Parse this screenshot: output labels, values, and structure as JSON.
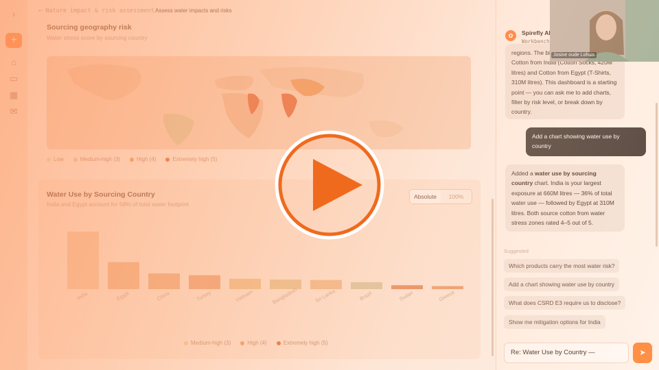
{
  "breadcrumb": {
    "back": "← Nature impact & risk assessment",
    "current": "Assess water impacts and risks"
  },
  "geo_panel": {
    "title": "Sourcing geography risk",
    "subtitle": "Water stress score by sourcing country",
    "legend": [
      {
        "label": "Low",
        "color": "#d9e3b5"
      },
      {
        "label": "Medium-high (3)",
        "color": "#f4c79c"
      },
      {
        "label": "High (4)",
        "color": "#ee9a5c"
      },
      {
        "label": "Extremely high (5)",
        "color": "#e2653a"
      }
    ]
  },
  "water_panel": {
    "title": "Water Use by Sourcing Country",
    "subtitle": "India and Egypt account for 58% of total water footprint",
    "toggle": [
      "Absolute",
      "100%"
    ],
    "legend": [
      {
        "label": "Medium-high (3)",
        "color": "#f4c79c"
      },
      {
        "label": "High (4)",
        "color": "#ee9a5c"
      },
      {
        "label": "Extremely high (5)",
        "color": "#e2653a"
      }
    ]
  },
  "chart_data": {
    "type": "bar",
    "title": "Water Use by Sourcing Country",
    "categories": [
      "India",
      "Egypt",
      "China",
      "Turkey",
      "Vietnam",
      "Bangladesh",
      "Sri Lanka",
      "Brazil",
      "Sudan",
      "Greece"
    ],
    "values": [
      660,
      310,
      180,
      160,
      120,
      110,
      105,
      80,
      45,
      35
    ],
    "colors": [
      "#f5c6a3",
      "#f2b48a",
      "#efae82",
      "#eda478",
      "#efbf8c",
      "#e8c290",
      "#f0ba88",
      "#d9c5a0",
      "#e8875a",
      "#ea9a68"
    ]
  },
  "chat": {
    "app_name": "Spirefly AI",
    "app_sub": "Workbench",
    "msg1": "regions. The biggest exposures are Cotton from India (Cotton Socks, 420M litres) and Cotton from Egypt (T-Shirts, 310M litres). This dashboard is a starting point — you can ask me to add charts, filter by risk level, or break down by country.",
    "user_msg": "Add a chart showing water use by country",
    "msg2_pre": "Added a ",
    "msg2_bold": "water use by sourcing country",
    "msg2_post": " chart. India is your largest exposure at 660M litres — 36% of total water use — followed by Egypt at 310M litres. Both source cotton from water stress zones rated 4–5 out of 5.",
    "suggested_label": "Suggested",
    "suggestions": [
      "Which products carry the most water risk?",
      "Add a chart showing water use by country",
      "What does CSRD E3 require us to disclose?",
      "Show me mitigation options for India"
    ],
    "input_value": "Re: Water Use by Country —"
  },
  "webcam": {
    "name": "Josine oude Lohuis"
  }
}
